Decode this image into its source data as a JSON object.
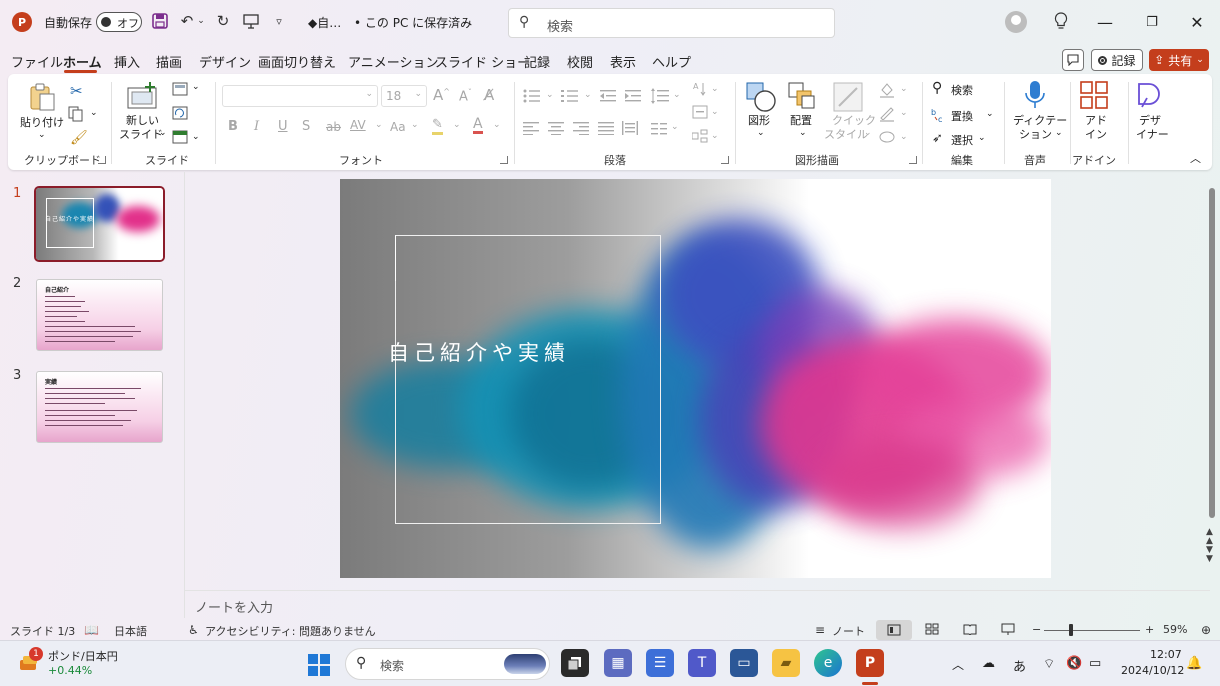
{
  "titlebar": {
    "autosave_label": "自動保存",
    "autosave_state": "オフ",
    "filename": "◆自…",
    "save_status": "• この PC に保存済み",
    "search_placeholder": "検索"
  },
  "menu": [
    "ファイル",
    "ホーム",
    "挿入",
    "描画",
    "デザイン",
    "画面切り替え",
    "アニメーション",
    "スライド ショー",
    "記録",
    "校閲",
    "表示",
    "ヘルプ"
  ],
  "menu_active": "ホーム",
  "actions": {
    "record": "記録",
    "share": "共有"
  },
  "ribbon": {
    "clipboard": {
      "paste": "貼り付け",
      "group": "クリップボード"
    },
    "slides": {
      "new_slide_1": "新しい",
      "new_slide_2": "スライド",
      "group": "スライド"
    },
    "font": {
      "size": "18",
      "grow": "A",
      "shrink": "A",
      "bold": "B",
      "italic": "I",
      "underline": "U",
      "shadow": "S",
      "strike": "ab",
      "spacing": "AV",
      "case": "Aa",
      "color": "A",
      "group": "フォント"
    },
    "paragraph": {
      "group": "段落"
    },
    "drawing": {
      "shapes": "図形",
      "arrange": "配置",
      "quickstyle_1": "クイック",
      "quickstyle_2": "スタイル",
      "group": "図形描画"
    },
    "editing": {
      "find": "検索",
      "replace": "置換",
      "select": "選択",
      "group": "編集"
    },
    "voice": {
      "dictate_1": "ディクテー",
      "dictate_2": "ション",
      "group": "音声"
    },
    "addins": {
      "label_1": "アド",
      "label_2": "イン",
      "group": "アドイン"
    },
    "designer": {
      "label_1": "デザ",
      "label_2": "イナー"
    }
  },
  "thumbnails": [
    {
      "num": "1",
      "title": "自己紹介や実績"
    },
    {
      "num": "2",
      "title": "自己紹介"
    },
    {
      "num": "3",
      "title": "実績"
    }
  ],
  "slide": {
    "title": "自己紹介や実績"
  },
  "notes_placeholder": "ノートを入力",
  "statusbar": {
    "slide_info": "スライド 1/3",
    "language": "日本語",
    "accessibility": "アクセシビリティ: 問題ありません",
    "notes": "ノート",
    "zoom": "59%"
  },
  "taskbar": {
    "weather_badge": "1",
    "weather_title": "ポンド/日本円",
    "weather_value": "+0.44%",
    "search_placeholder": "検索",
    "ime": "あ",
    "time": "12:07",
    "date": "2024/10/12"
  },
  "colors": {
    "accent": "#c43e1c",
    "selected_border": "#8b1c2a"
  }
}
